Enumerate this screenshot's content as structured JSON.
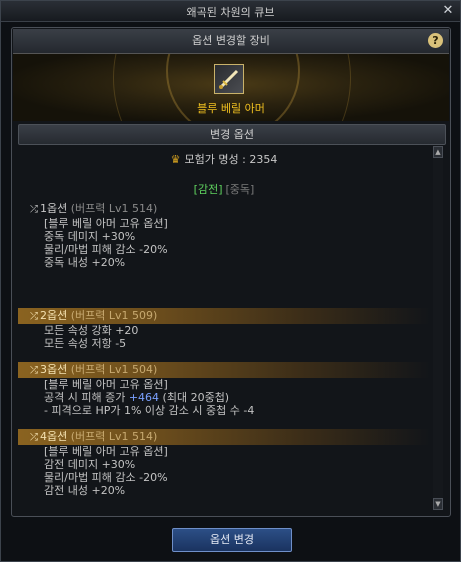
{
  "window": {
    "title": "왜곡된 차원의 큐브",
    "close_glyph": "✕"
  },
  "equipment_panel": {
    "header": "옵션 변경할 장비",
    "help_glyph": "?",
    "item_name": "블루 베릴 아머",
    "item_icon": "sword-icon"
  },
  "change_options": {
    "header": "변경 옵션",
    "fame_label": "모험가 명성 : 2354",
    "tags": {
      "active": "[감전]",
      "inactive": "[중독]"
    },
    "options": [
      {
        "head": "1옵션",
        "buff": "(버프력 Lv1 514)",
        "highlighted": false,
        "lines": [
          "[블루 베릴 아머 고유 옵션]",
          "중독 데미지 +30%",
          "물리/마법 피해 감소 -20%",
          "중독 내성 +20%"
        ]
      },
      {
        "head": "2옵션",
        "buff": "(버프력 Lv1 509)",
        "highlighted": true,
        "lines": [
          "모든 속성 강화 +20",
          "모든 속성 저항 -5"
        ]
      },
      {
        "head": "3옵션",
        "buff": "(버프력 Lv1 504)",
        "highlighted": true,
        "lines": [
          "[블루 베릴 아머 고유 옵션]"
        ],
        "line_damage": {
          "prefix": "공격 시 피해 증가 ",
          "value": "+464",
          "suffix": " (최대 20중첩)"
        },
        "line_sub": "- 피격으로 HP가 1% 이상 감소 시 중첩 수 -4"
      },
      {
        "head": "4옵션",
        "buff": "(버프력 Lv1 514)",
        "highlighted": true,
        "lines": [
          "[블루 베릴 아머 고유 옵션]",
          "감전 데미지 +30%",
          "물리/마법 피해 감소 -20%",
          "감전 내성 +20%"
        ]
      }
    ]
  },
  "scrollbar": {
    "up_glyph": "▲",
    "down_glyph": "▼"
  },
  "footer": {
    "change_button": "옵션 변경"
  },
  "colors": {
    "item_name": "#f0c020",
    "tag_active": "#5fd35f",
    "highlight_value": "#7aa0ff",
    "button": "#2c4f86"
  }
}
